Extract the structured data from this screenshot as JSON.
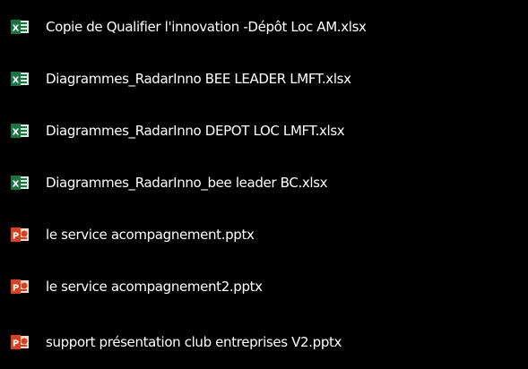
{
  "colors": {
    "background": "#000000",
    "text": "#ffffff",
    "excel_green": "#1e7145",
    "excel_light": "#d6ecdc",
    "powerpoint_red": "#d04423",
    "powerpoint_light": "#f6d8c9"
  },
  "files": [
    {
      "name": "Copie de Qualifier l'innovation -Dépôt Loc AM.xlsx",
      "icon": "excel-file-icon"
    },
    {
      "name": "Diagrammes_RadarInno BEE LEADER LMFT.xlsx",
      "icon": "excel-file-icon"
    },
    {
      "name": "Diagrammes_RadarInno DEPOT LOC LMFT.xlsx",
      "icon": "excel-file-icon"
    },
    {
      "name": "Diagrammes_RadarInno_bee leader BC.xlsx",
      "icon": "excel-file-icon"
    },
    {
      "name": "le service acompagnement.pptx",
      "icon": "powerpoint-file-icon"
    },
    {
      "name": "le service acompagnement2.pptx",
      "icon": "powerpoint-file-icon"
    },
    {
      "name": "support présentation club entreprises V2.pptx",
      "icon": "powerpoint-file-icon"
    }
  ]
}
